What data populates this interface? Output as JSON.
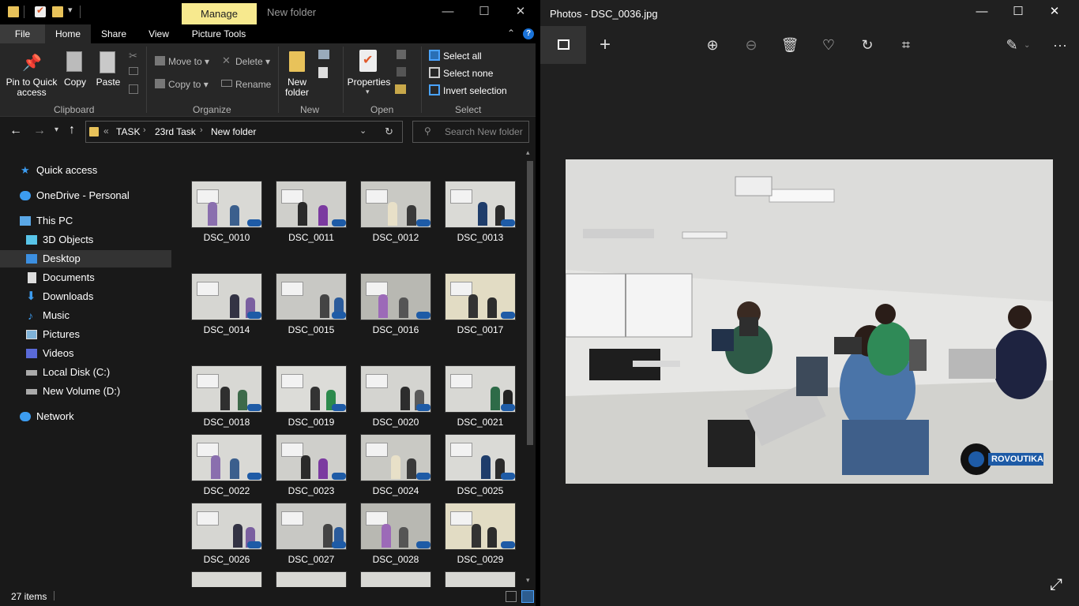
{
  "explorer": {
    "manage_tab": "Manage",
    "window_title": "New folder",
    "menu": {
      "file": "File",
      "home": "Home",
      "share": "Share",
      "view": "View",
      "picture_tools": "Picture Tools"
    },
    "ribbon": {
      "pin": "Pin to Quick access",
      "copy": "Copy",
      "paste": "Paste",
      "move_to": "Move to",
      "copy_to": "Copy to",
      "delete": "Delete",
      "rename": "Rename",
      "new_folder": "New folder",
      "properties": "Properties",
      "select_all": "Select all",
      "select_none": "Select none",
      "invert_selection": "Invert selection",
      "groups": {
        "clipboard": "Clipboard",
        "organize": "Organize",
        "new": "New",
        "open": "Open",
        "select": "Select"
      }
    },
    "address": {
      "crumb1": "TASK",
      "crumb2": "23rd Task",
      "crumb3": "New folder",
      "overflow": "«"
    },
    "search_placeholder": "Search New folder",
    "nav": {
      "quick_access": "Quick access",
      "onedrive": "OneDrive - Personal",
      "this_pc": "This PC",
      "objects3d": "3D Objects",
      "desktop": "Desktop",
      "documents": "Documents",
      "downloads": "Downloads",
      "music": "Music",
      "pictures": "Pictures",
      "videos": "Videos",
      "local_disk": "Local Disk (C:)",
      "new_volume": "New Volume (D:)",
      "network": "Network"
    },
    "files": [
      "DSC_0010",
      "DSC_0011",
      "DSC_0012",
      "DSC_0013",
      "DSC_0014",
      "DSC_0015",
      "DSC_0016",
      "DSC_0017",
      "DSC_0018",
      "DSC_0019",
      "DSC_0020",
      "DSC_0021",
      "DSC_0022",
      "DSC_0023",
      "DSC_0024",
      "DSC_0025",
      "DSC_0026",
      "DSC_0027",
      "DSC_0028",
      "DSC_0029"
    ],
    "status": "27 items"
  },
  "photos": {
    "title": "Photos - DSC_0036.jpg",
    "watermark": "ROVOUTIKA"
  },
  "colors": {
    "accent": "#f7e98e",
    "explorer_bg": "#191919",
    "ribbon_bg": "#272727",
    "photos_bg": "#202020"
  }
}
